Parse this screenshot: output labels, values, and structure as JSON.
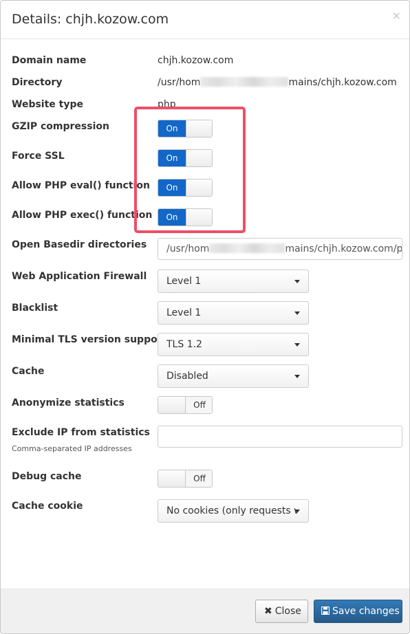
{
  "dialog": {
    "title": "Details: chjh.kozow.com",
    "close_glyph": "×"
  },
  "rows": {
    "domain_name": {
      "label": "Domain name",
      "value": "chjh.kozow.com"
    },
    "directory": {
      "label": "Directory",
      "value_prefix": "/usr/hom",
      "value_suffix": "mains/chjh.kozow.com"
    },
    "website_type": {
      "label": "Website type",
      "value": "php"
    },
    "gzip": {
      "label": "GZIP compression",
      "state_label": "On",
      "enabled": true
    },
    "force_ssl": {
      "label": "Force SSL",
      "state_label": "On",
      "enabled": true
    },
    "php_eval": {
      "label": "Allow PHP eval() function",
      "state_label": "On",
      "enabled": true
    },
    "php_exec": {
      "label": "Allow PHP exec() function",
      "state_label": "On",
      "enabled": true
    },
    "open_basedir": {
      "label": "Open Basedir directories",
      "value_prefix": "/usr/hom",
      "value_suffix": "mains/chjh.kozow.com/p"
    },
    "waf": {
      "label": "Web Application Firewall",
      "selected": "Level 1"
    },
    "blacklist": {
      "label": "Blacklist",
      "selected": "Level 1"
    },
    "tls": {
      "label": "Minimal TLS version support",
      "selected": "TLS 1.2"
    },
    "cache": {
      "label": "Cache",
      "selected": "Disabled"
    },
    "anonymize": {
      "label": "Anonymize statistics",
      "state_label": "Off",
      "enabled": false
    },
    "exclude_ip": {
      "label": "Exclude IP from statistics",
      "hint": "Comma-separated IP addresses",
      "value": ""
    },
    "debug_cache": {
      "label": "Debug cache",
      "state_label": "Off",
      "enabled": false
    },
    "cache_cookie": {
      "label": "Cache cookie",
      "selected": "No cookies (only requests w"
    }
  },
  "footer": {
    "close_label": "Close",
    "close_icon": "x-icon",
    "save_label": "Save changes",
    "save_icon": "floppy-disk-icon"
  },
  "colors": {
    "toggle_on": "#1267c9",
    "highlight": "#ee4f67",
    "primary_button": "#337ab7"
  }
}
